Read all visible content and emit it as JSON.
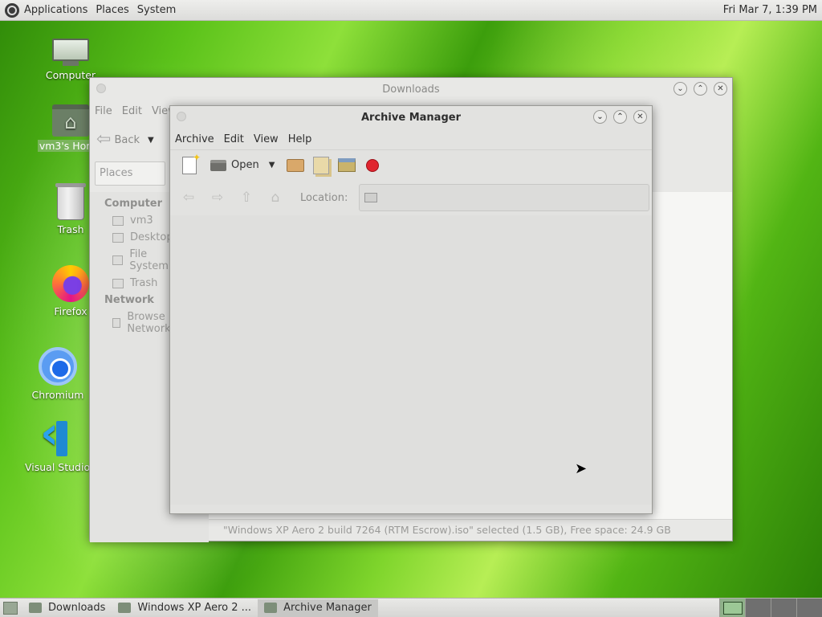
{
  "top_panel": {
    "menus": [
      "Applications",
      "Places",
      "System"
    ],
    "clock": "Fri Mar  7,  1:39 PM"
  },
  "desktop_icons": [
    {
      "label": "Computer",
      "icon": "computer-icon"
    },
    {
      "label": "vm3's Home",
      "icon": "home-folder-icon",
      "selected": true
    },
    {
      "label": "Trash",
      "icon": "trash-icon"
    },
    {
      "label": "Firefox",
      "icon": "firefox-icon"
    },
    {
      "label": "Chromium",
      "icon": "chromium-icon"
    },
    {
      "label": "Visual Studio Code",
      "icon": "vscode-icon"
    }
  ],
  "downloads_window": {
    "title": "Downloads",
    "menus": [
      "File",
      "Edit",
      "View"
    ],
    "back_label": "Back",
    "places_combo": "Places",
    "sidebar": {
      "computer_heading": "Computer",
      "computer_items": [
        "vm3",
        "Desktop",
        "File System",
        "Trash"
      ],
      "network_heading": "Network",
      "network_items": [
        "Browse Network"
      ]
    },
    "status": "\"Windows XP Aero 2 build 7264 (RTM Escrow).iso\" selected (1.5 GB), Free space: 24.9 GB"
  },
  "archive_window": {
    "title": "Archive Manager",
    "menus": [
      "Archive",
      "Edit",
      "View",
      "Help"
    ],
    "open_label": "Open",
    "location_label": "Location:"
  },
  "taskbar": {
    "tasks": [
      {
        "label": "Downloads",
        "active": false
      },
      {
        "label": "Windows XP Aero 2 ...",
        "active": false
      },
      {
        "label": "Archive Manager",
        "active": true
      }
    ]
  }
}
